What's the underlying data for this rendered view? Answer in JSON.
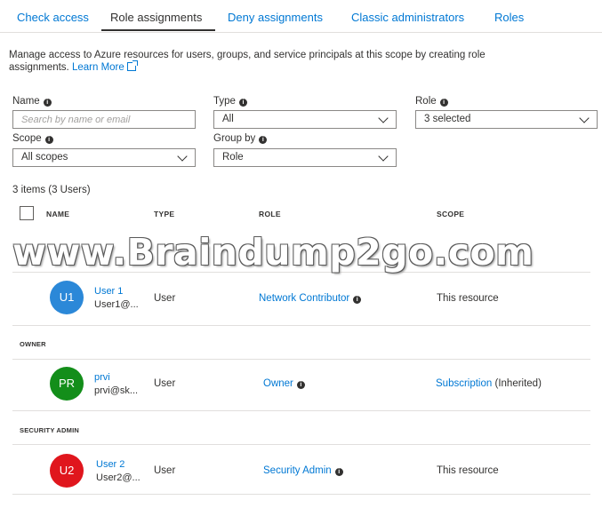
{
  "tabs": [
    {
      "label": "Check access"
    },
    {
      "label": "Role assignments"
    },
    {
      "label": "Deny assignments"
    },
    {
      "label": "Classic administrators"
    },
    {
      "label": "Roles"
    }
  ],
  "intro": {
    "text": "Manage access to Azure resources for users, groups, and service principals at this scope by creating role assignments.",
    "learn_more": "Learn More"
  },
  "filters": {
    "name": {
      "label": "Name",
      "placeholder": "Search by name or email"
    },
    "type": {
      "label": "Type",
      "value": "All"
    },
    "role": {
      "label": "Role",
      "value": "3 selected"
    },
    "scope": {
      "label": "Scope",
      "value": "All scopes"
    },
    "group_by": {
      "label": "Group by",
      "value": "Role"
    }
  },
  "count_text": "3 items (3 Users)",
  "columns": {
    "name": "NAME",
    "type": "TYPE",
    "role": "ROLE",
    "scope": "SCOPE"
  },
  "watermark": "www.Braindump2go.com",
  "groups": [
    {
      "label": "",
      "rows": [
        {
          "initials": "U1",
          "avatar_color": "#2b88d8",
          "name": "User 1",
          "email": "User1@...",
          "type": "User",
          "role": "Network Contributor",
          "scope": "This resource",
          "scope_suffix": ""
        }
      ]
    },
    {
      "label": "OWNER",
      "rows": [
        {
          "initials": "PR",
          "avatar_color": "#138e1a",
          "name": "prvi",
          "email": "prvi@sk...",
          "type": "User",
          "role": "Owner",
          "scope": "Subscription",
          "scope_suffix": "(Inherited)"
        }
      ]
    },
    {
      "label": "SECURITY ADMIN",
      "rows": [
        {
          "initials": "U2",
          "avatar_color": "#e0161d",
          "name": "User 2",
          "email": "User2@...",
          "type": "User",
          "role": "Security Admin",
          "scope": "This resource",
          "scope_suffix": ""
        }
      ]
    }
  ]
}
